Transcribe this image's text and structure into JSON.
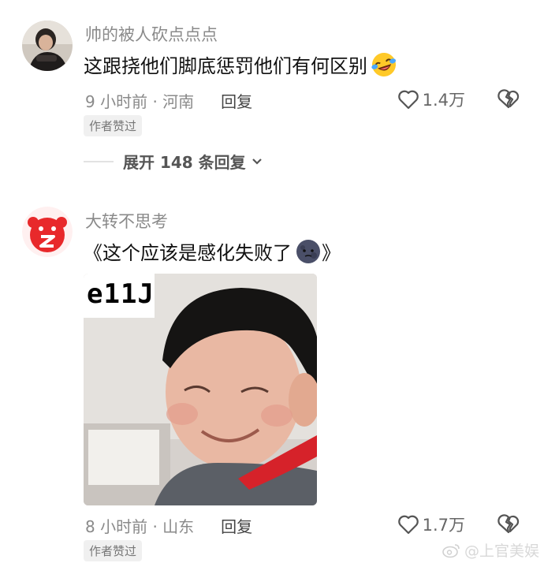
{
  "comments": [
    {
      "username": "帅的被人砍点点点",
      "text": "这跟挠他们脚底惩罚他们有何区别",
      "emoji": "laugh-cry-emoji",
      "time_location": "9 小时前 · 河南",
      "reply_label": "回复",
      "likes": "1.4万",
      "badge": "作者赞过"
    },
    {
      "username": "大转不思考",
      "text_before": "《这个应该是感化失败了",
      "emoji": "dark-moon-emoji",
      "text_after": "》",
      "image_caption": "e11J",
      "time_location": "8 小时前 · 山东",
      "reply_label": "回复",
      "likes": "1.7万",
      "badge": "作者赞过"
    }
  ],
  "expand_replies": "展开 148 条回复",
  "watermark": "@上官美娱",
  "colors": {
    "muted": "#8a8a8a",
    "badge_bg": "#f0f0f0",
    "avatar2_red": "#e8292b"
  }
}
